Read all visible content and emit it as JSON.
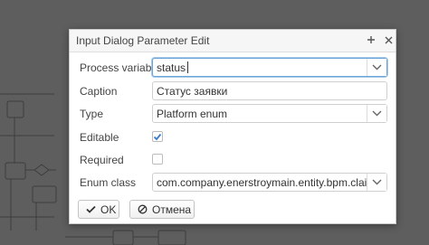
{
  "dialog": {
    "title": "Input Dialog Parameter Edit",
    "maximize_icon": "plus-icon",
    "close_icon": "close-icon"
  },
  "form": {
    "process_variable": {
      "label": "Process variable",
      "value": "status"
    },
    "caption": {
      "label": "Caption",
      "value": "Статус заявки"
    },
    "type": {
      "label": "Type",
      "value": "Platform enum"
    },
    "editable": {
      "label": "Editable",
      "checked": true
    },
    "required": {
      "label": "Required",
      "checked": false
    },
    "enum_class": {
      "label": "Enum class",
      "value": "com.company.enerstroymain.entity.bpm.claim.en"
    }
  },
  "buttons": {
    "ok_label": "OK",
    "cancel_label": "Отмена"
  },
  "colors": {
    "accent": "#6aa5d9",
    "checkmark": "#3a7bc8",
    "overlay": "#5e5e5e"
  }
}
